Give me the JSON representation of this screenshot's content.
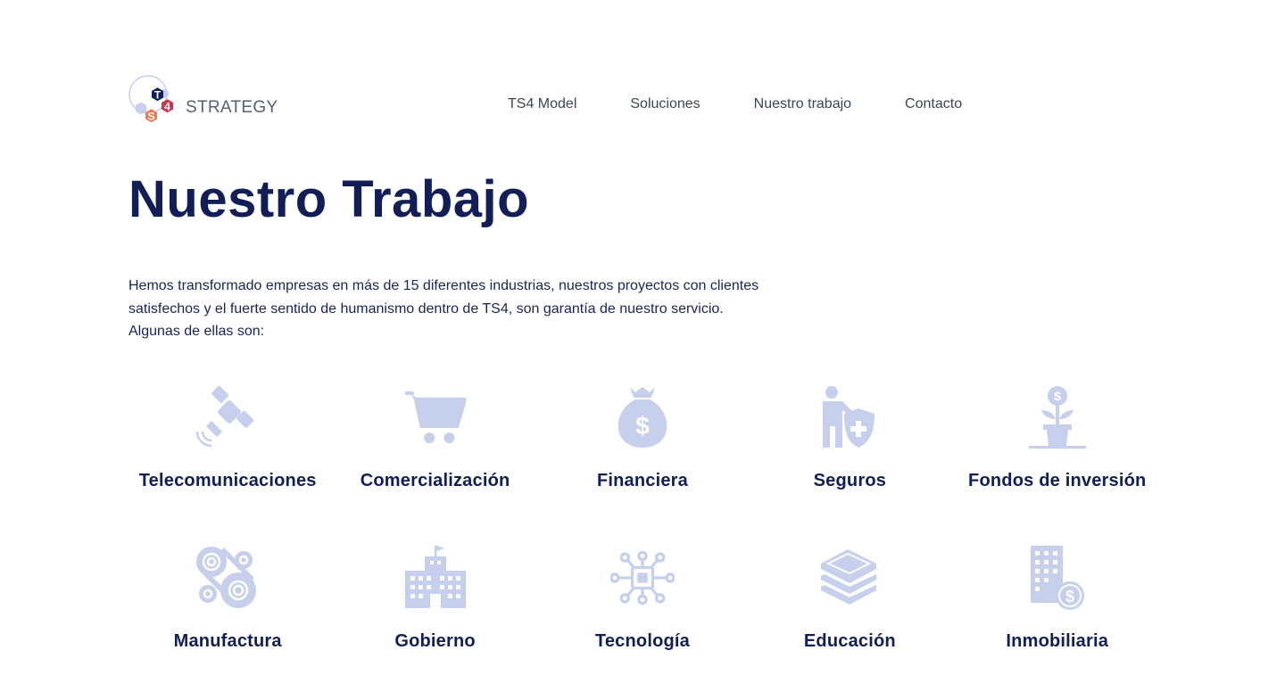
{
  "header": {
    "logo_text": "STRATEGY",
    "logo_letters": {
      "t": "T",
      "four": "4",
      "s": "S"
    },
    "nav": [
      {
        "label": "TS4 Model"
      },
      {
        "label": "Soluciones"
      },
      {
        "label": "Nuestro trabajo"
      },
      {
        "label": "Contacto"
      }
    ]
  },
  "main": {
    "title": "Nuestro Trabajo",
    "intro": "Hemos transformado empresas en más de 15 diferentes industrias, nuestros proyectos con clientes satisfechos y el fuerte sentido de humanismo dentro de TS4, son garantía de nuestro servicio. Algunas de ellas son:",
    "industries": [
      {
        "label": "Telecomunicaciones",
        "icon": "satellite-icon"
      },
      {
        "label": "Comercialización",
        "icon": "shopping-cart-icon"
      },
      {
        "label": "Financiera",
        "icon": "money-bag-icon"
      },
      {
        "label": "Seguros",
        "icon": "person-shield-icon"
      },
      {
        "label": "Fondos de inversión",
        "icon": "money-plant-icon"
      },
      {
        "label": "Manufactura",
        "icon": "gears-icon"
      },
      {
        "label": "Gobierno",
        "icon": "government-building-icon"
      },
      {
        "label": "Tecnología",
        "icon": "circuit-chip-icon"
      },
      {
        "label": "Educación",
        "icon": "books-icon"
      },
      {
        "label": "Inmobiliaria",
        "icon": "building-dollar-icon"
      }
    ]
  },
  "colors": {
    "title": "#111e57",
    "icon": "#c6cfec",
    "logo_navy": "#0f1f5c",
    "logo_red": "#d0334a",
    "logo_orange": "#ef7b57",
    "logo_grey": "#c6cfec"
  }
}
